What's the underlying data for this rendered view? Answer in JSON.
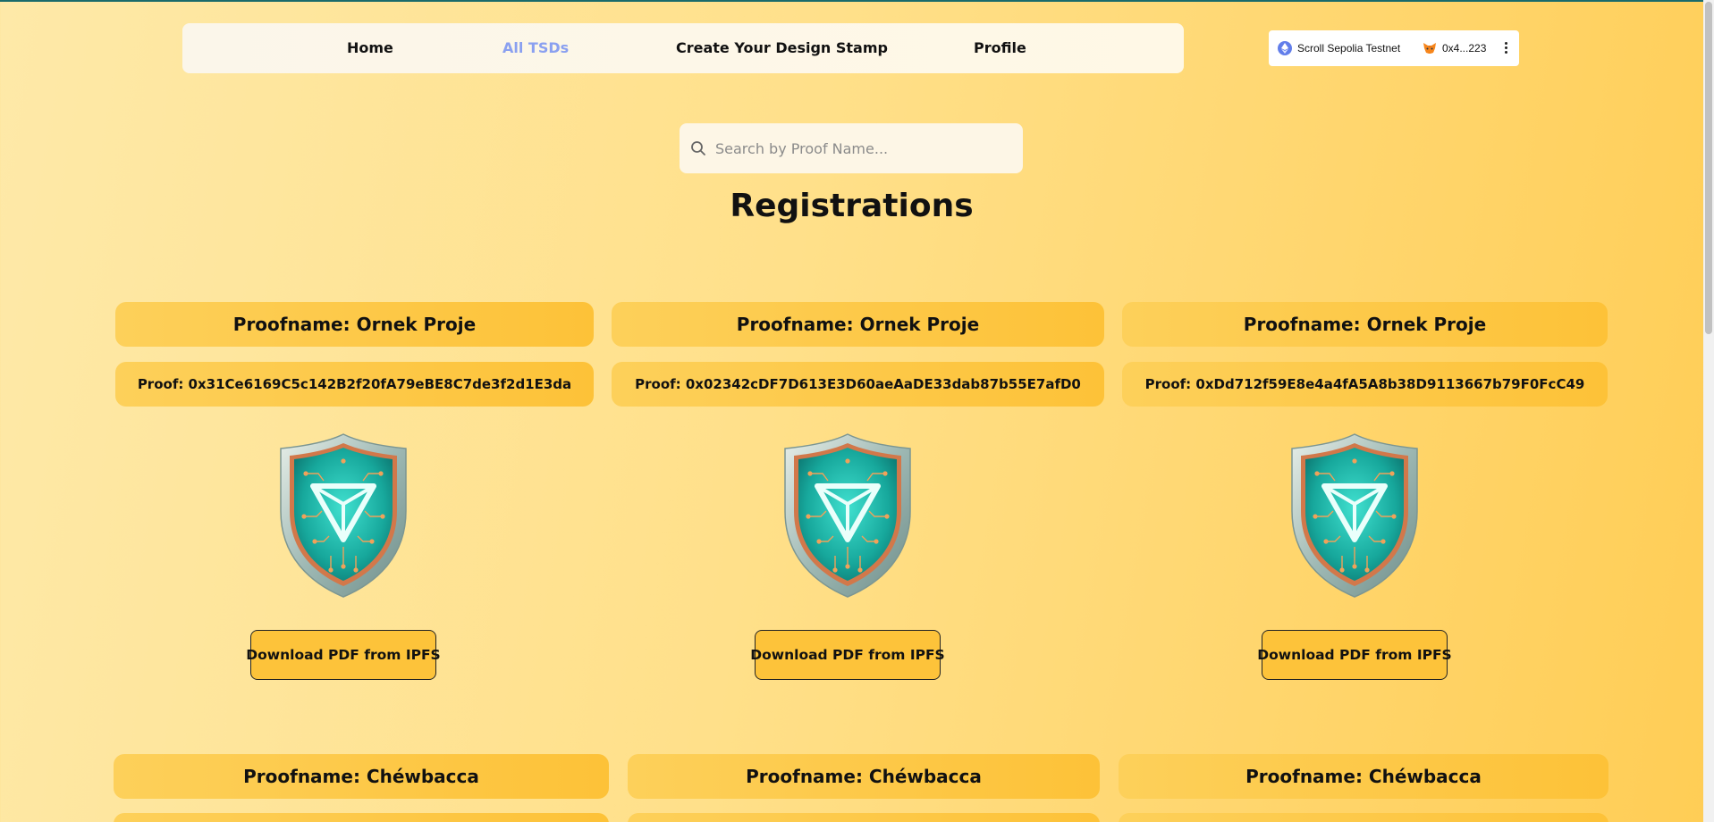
{
  "nav": {
    "items": [
      {
        "label": "Home",
        "active": false
      },
      {
        "label": "All TSDs",
        "active": true
      },
      {
        "label": "Create Your Design Stamp",
        "active": false
      },
      {
        "label": "Profile",
        "active": false
      }
    ]
  },
  "wallet": {
    "network": "Scroll Sepolia Testnet",
    "account": "0x4...223",
    "network_icon": "ethereum-icon",
    "account_icon": "metamask-fox-icon"
  },
  "search": {
    "placeholder": "Search by Proof Name..."
  },
  "page_title": "Registrations",
  "cards_row1": [
    {
      "proofname": "Proofname: Ornek Proje",
      "proof": "Proof: 0x31Ce6169C5c142B2f20fA79eBE8C7de3f2d1E3da",
      "download_label": "Download PDF from IPFS"
    },
    {
      "proofname": "Proofname: Ornek Proje",
      "proof": "Proof: 0x02342cDF7D613E3D60aeAaDE33dab87b55E7afD0",
      "download_label": "Download PDF from IPFS"
    },
    {
      "proofname": "Proofname: Ornek Proje",
      "proof": "Proof: 0xDd712f59E8e4a4fA5A8b38D9113667b79F0FcC49",
      "download_label": "Download PDF from IPFS"
    }
  ],
  "cards_row2": [
    {
      "proofname": "Proofname: Chéwbacca"
    },
    {
      "proofname": "Proofname: Chéwbacca"
    },
    {
      "proofname": "Proofname: Chéwbacca"
    }
  ],
  "colors": {
    "active_nav": "#8aa0f0",
    "pill": "#fdc238",
    "accent_border": "#1a6b6b"
  }
}
